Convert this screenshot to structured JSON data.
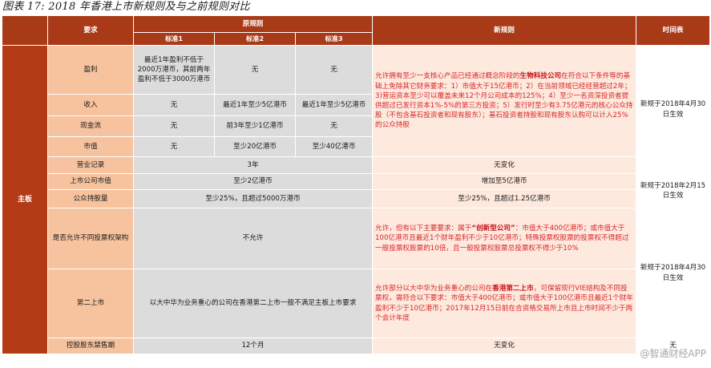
{
  "caption": "图表 17: 2018 年香港上市新规则及与之前规则对比",
  "header": {
    "req": "要求",
    "old_rules": "原规则",
    "std1": "标准1",
    "std2": "标准2",
    "std3": "标准3",
    "new_rules": "新规则",
    "timeline": "时间表"
  },
  "side_label": "主板",
  "rows": {
    "profit": {
      "label": "盈利",
      "s1": "最近1年盈利不低于2000万港币，其前两年盈利不低于3000万港币",
      "s2": "无",
      "s3": "无"
    },
    "revenue": {
      "label": "收入",
      "s1": "无",
      "s2": "最近1年至少5亿港币",
      "s3": "最近1年至少5亿港币"
    },
    "cashflow": {
      "label": "现金流",
      "s1": "无",
      "s2": "前3年至少1亿港币",
      "s3": "无"
    },
    "mktcap": {
      "label": "市值",
      "s1": "无",
      "s2": "至少20亿港币",
      "s3": "至少40亿港币"
    },
    "biotech_new": {
      "p1": "允许拥有至少一支核心产品已经通过概念阶段的",
      "hl": "生物科技公司",
      "p2": "在符合以下条件等的基础上免除其它财务要求：1）市值大于15亿港币；2）在当前领域已经经营超过2年；3)营运资本至少可以覆盖未来12个月公司成本的125%；4）至少一名资深投资者提供超过已发行资本1%-5%的第三方投资；5）发行时至少有3.75亿港元的核心公众持股（不包含基石投资者和现有股东）；基石投资者持股和现有股东认购可以计入25%的公众持股"
    },
    "track": {
      "label": "营业记录",
      "old": "3年",
      "new": "无变化"
    },
    "listed_cap": {
      "label": "上市公司市值",
      "old": "至少2亿港币",
      "new": "增加至5亿港币"
    },
    "public": {
      "label": "公众持股量",
      "old": "至少25%，且超过5000万港币",
      "new": "至少25%，且超过1.25亿港币"
    },
    "wvr": {
      "label": "是否允许不同投票权架构",
      "old": "不允许",
      "p1": "允许，但有以下主要要求：属于",
      "hl": "“创新型公司”",
      "p2": "：市值大于400亿港币；或市值大于100亿港币且最近1个财年盈利不少于10亿港币；特殊投票权股票的投票权不得超过一般投票权股票的10倍，且一般投票权股票总投票权不得少于10%"
    },
    "secondary": {
      "label": "第二上市",
      "old": "以大中华为业务重心的公司在香港第二上市一般不满足主板上市要求",
      "p1": "允许部分以大中华为业务重心的公司在",
      "hl": "香港第二上市",
      "p2": "，可保留现行VIE结构及不同投票权，需符合以下要求：市值大于400亿港币；或市值大于100亿港币且最近1个财年盈利不少于10亿港币；2017年12月15日前在合资格交易所上市且上市时间不少于两个会计年度"
    },
    "lockup": {
      "label": "控股股东禁售期",
      "old": "12个月",
      "new": "无变化"
    }
  },
  "timeline": {
    "t1": "新规于2018年4月30日生效",
    "t2": "新规于2018年2月15日生效",
    "t3": "新规于2018年4月30日生效",
    "t4": "无"
  },
  "watermark": "@智通财经APP"
}
